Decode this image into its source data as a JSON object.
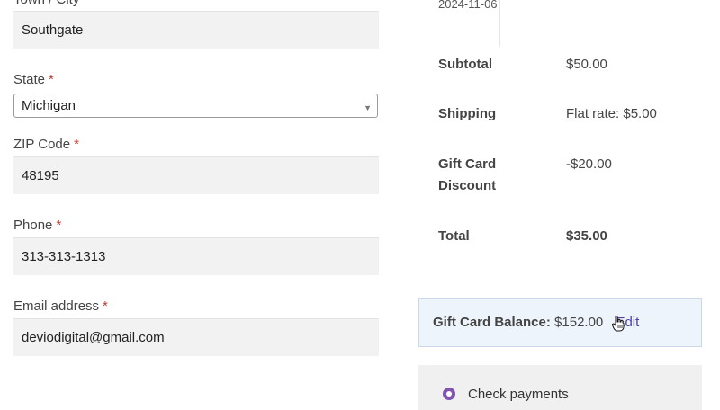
{
  "billing": {
    "town_label": "Town / City",
    "town_value": "Southgate",
    "state_label": "State",
    "state_value": "Michigan",
    "zip_label": "ZIP Code",
    "zip_value": "48195",
    "phone_label": "Phone",
    "phone_value": "313-313-1313",
    "email_label": "Email address",
    "email_value": "deviodigital@gmail.com",
    "required_mark": "*"
  },
  "order": {
    "date": "2024-11-06",
    "subtotal_label": "Subtotal",
    "subtotal_value": "$50.00",
    "shipping_label": "Shipping",
    "shipping_value": "Flat rate: $5.00",
    "gift_discount_label_1": "Gift Card",
    "gift_discount_label_2": "Discount",
    "gift_discount_value": "-$20.00",
    "total_label": "Total",
    "total_value": "$35.00"
  },
  "gift_card": {
    "balance_label": "Gift Card Balance:",
    "balance_value": "$152.00",
    "edit_label": "Edit"
  },
  "payment": {
    "method_label": "Check payments",
    "accent_color": "#7f54b3"
  },
  "icons": {
    "cursor": "hand-pointer-icon",
    "select": "chevron-down-icon"
  }
}
